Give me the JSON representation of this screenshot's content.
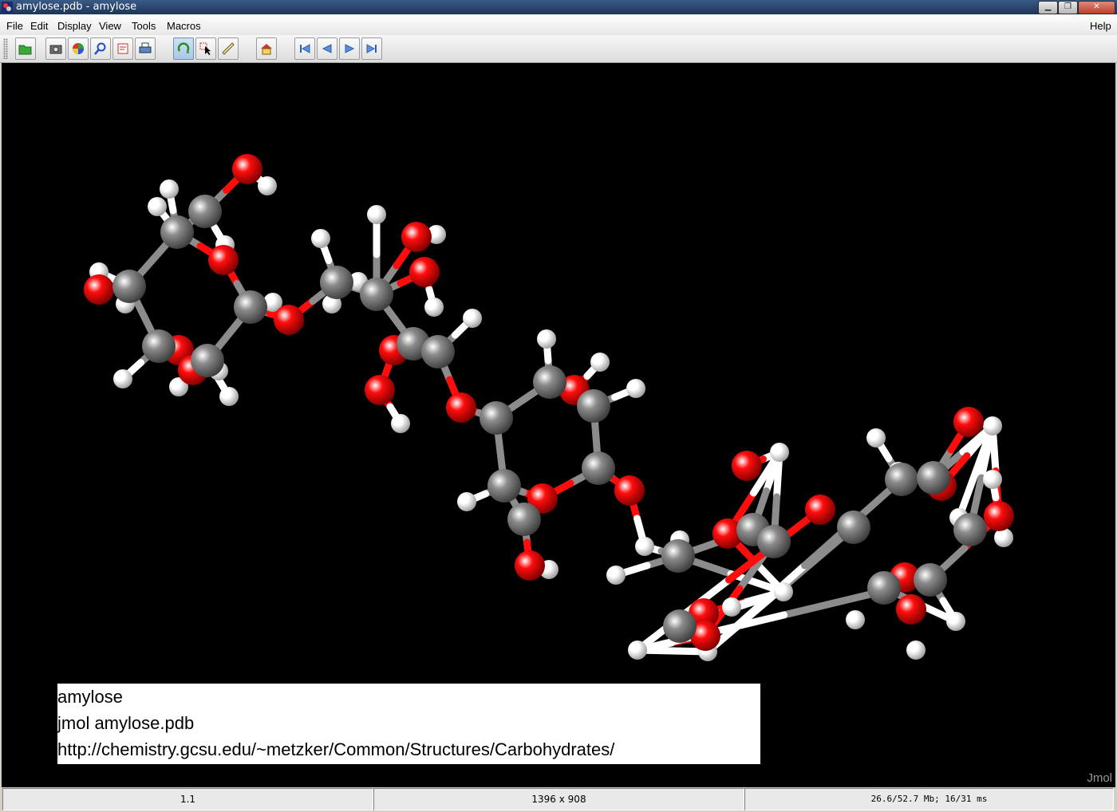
{
  "window": {
    "title": "amylose.pdb - amylose",
    "minimize_label": "▁",
    "maximize_label": "❐",
    "close_label": "✕"
  },
  "menu": {
    "items": [
      {
        "label": "File"
      },
      {
        "label": "Edit"
      },
      {
        "label": "Display"
      },
      {
        "label": "View"
      },
      {
        "label": "Tools"
      },
      {
        "label": "Macros"
      }
    ],
    "help": "Help"
  },
  "toolbar": {
    "buttons": [
      {
        "icon": "open-folder-icon"
      },
      {
        "icon": "screenshot-camera-icon"
      },
      {
        "icon": "color-wheel-icon"
      },
      {
        "icon": "zoom-icon"
      },
      {
        "icon": "editor-icon"
      },
      {
        "icon": "print-icon"
      },
      {
        "icon": "rotate-icon",
        "active": true
      },
      {
        "icon": "pick-cursor-icon"
      },
      {
        "icon": "measure-ruler-icon"
      },
      {
        "icon": "home-icon"
      },
      {
        "icon": "first-frame-icon"
      },
      {
        "icon": "previous-frame-icon"
      },
      {
        "icon": "next-frame-icon"
      },
      {
        "icon": "last-frame-icon"
      }
    ]
  },
  "viewer": {
    "background": "#000000",
    "atom_colors": {
      "carbon": "#8c8c8c",
      "oxygen": "#ff0d0d",
      "hydrogen": "#ffffff"
    },
    "echo_lines": [
      "amylose",
      "jmol  amylose.pdb",
      "http://chemistry.gcsu.edu/~metzker/Common/Structures/Carbohydrates/"
    ],
    "watermark": "Jmol"
  },
  "status": {
    "frame": "1.1",
    "size": "1396 x 908",
    "memory": "26.6/52.7 Mb;  16/31 ms"
  }
}
